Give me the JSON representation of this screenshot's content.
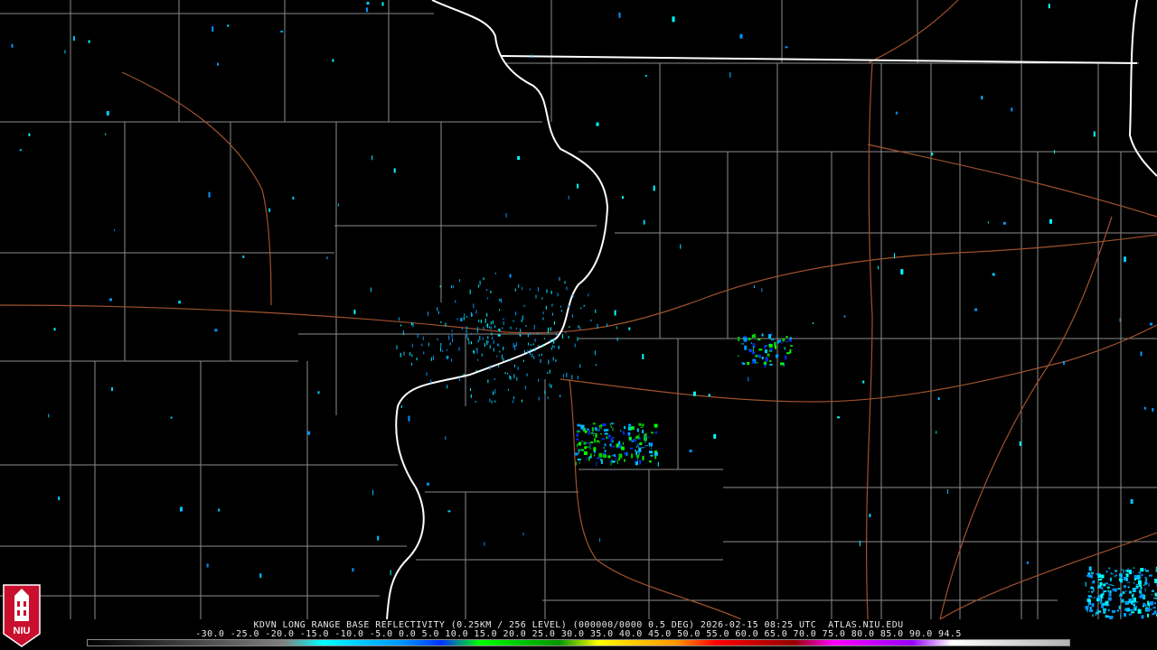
{
  "product": {
    "title": "KDVN LONG RANGE BASE REFLECTIVITY (0.25KM / 256 LEVEL) (000000/0000 0.5 DEG) 2026-02-15 08:25 UTC  ATLAS.NIU.EDU"
  },
  "colorbar": {
    "ticks": [
      "-30.0",
      "-25.0",
      "-20.0",
      "-15.0",
      "-10.0",
      "-5.0",
      "0.0",
      "5.0",
      "10.0",
      "15.0",
      "20.0",
      "25.0",
      "30.0",
      "35.0",
      "40.0",
      "45.0",
      "50.0",
      "55.0",
      "60.0",
      "65.0",
      "70.0",
      "75.0",
      "80.0",
      "85.0",
      "90.0",
      "94.5"
    ],
    "colors": [
      "#000000",
      "#1a1a1a",
      "#333333",
      "#4d4d4d",
      "#666666",
      "#808080",
      "#00ffff",
      "#00c8ff",
      "#0096ff",
      "#0032ff",
      "#00ff00",
      "#00c800",
      "#009600",
      "#ffff00",
      "#ffc800",
      "#ff9600",
      "#ff0000",
      "#c80000",
      "#960000",
      "#ff00ff",
      "#c800ff",
      "#9600ff",
      "#ffffff",
      "#e6e6e6",
      "#cccccc",
      "#b3b3b3"
    ]
  },
  "map_style": {
    "state_border_color": "#ffffff",
    "county_border_color": "#8c8c8c",
    "highway_color": "#a0522d"
  },
  "logo": {
    "text": "NIU",
    "icon": "university-tower-icon",
    "color": "#c8102e"
  }
}
